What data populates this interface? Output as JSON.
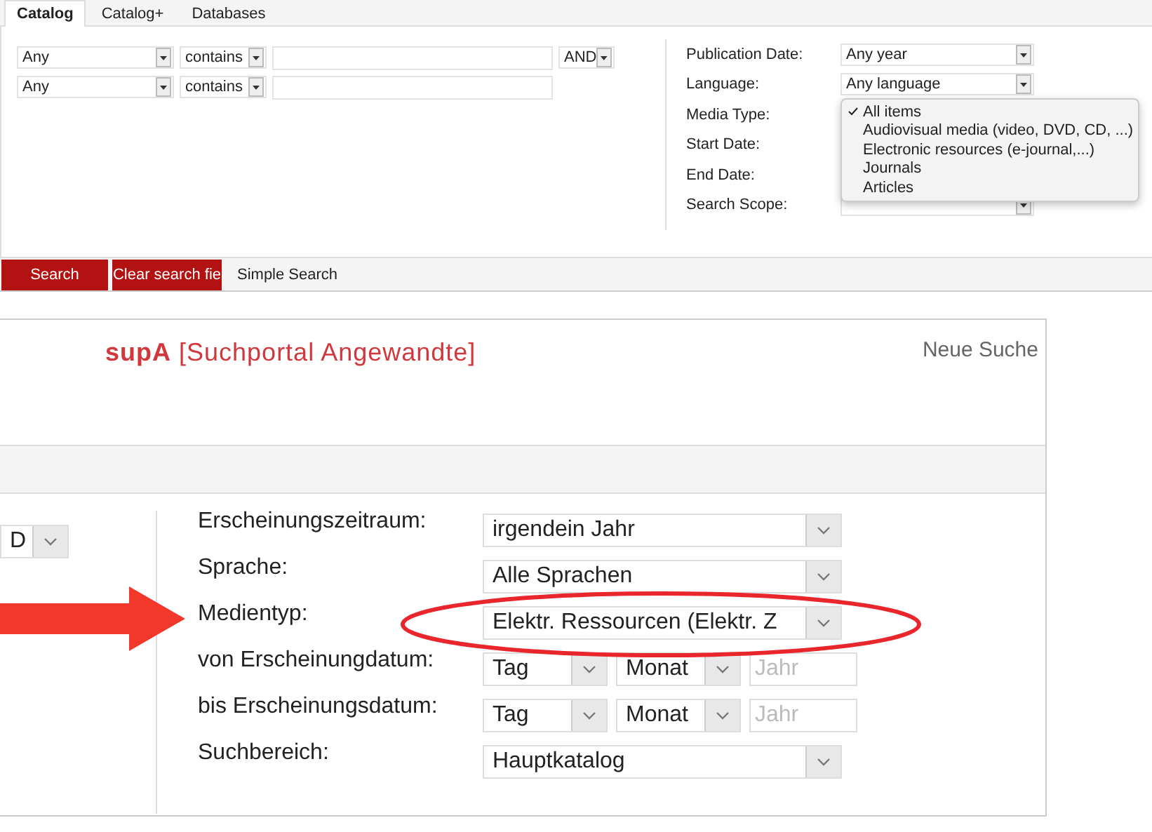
{
  "top_panel": {
    "tabs": [
      {
        "label": "Catalog",
        "selected": true
      },
      {
        "label": "Catalog+",
        "selected": false
      },
      {
        "label": "Databases",
        "selected": false
      }
    ],
    "query_rows": [
      {
        "field": "Any",
        "operator": "contains",
        "boolean": "AND"
      },
      {
        "field": "Any",
        "operator": "contains"
      }
    ],
    "filters": [
      {
        "kind": "select",
        "label": "Publication Date:",
        "value": "Any year"
      },
      {
        "kind": "select",
        "label": "Language:",
        "value": "Any language"
      },
      {
        "kind": "label_only",
        "label": "Media Type:"
      },
      {
        "kind": "label_only",
        "label": "Start Date:"
      },
      {
        "kind": "label_only",
        "label": "End Date:"
      },
      {
        "kind": "select",
        "label": "Search Scope:"
      }
    ],
    "media_type_menu": [
      {
        "label": "All items",
        "selected": true
      },
      {
        "label": "Audiovisual media (video, DVD, CD, ...)",
        "selected": false
      },
      {
        "label": "Electronic resources (e-journal,...)",
        "selected": false
      },
      {
        "label": "Journals",
        "selected": false
      },
      {
        "label": "Articles",
        "selected": false
      }
    ],
    "buttons": [
      "Search",
      "Clear search fie"
    ],
    "simple_search_link": "Simple Search"
  },
  "bottom_panel": {
    "logo": {
      "brand": "supA",
      "subtitle": "[Suchportal Angewandte]"
    },
    "new_search_link": "Neue Suche",
    "boolean_select_fragment": "D",
    "filters": [
      {
        "kind": "select",
        "label": "Erscheinungszeitraum:",
        "value": "irgendein Jahr"
      },
      {
        "kind": "select",
        "label": "Sprache:",
        "value": "Alle Sprachen"
      },
      {
        "kind": "select",
        "label": "Medientyp:",
        "value": "Elektr. Ressourcen (Elektr. Z"
      },
      {
        "kind": "date",
        "label": "von Erscheinungdatum:",
        "day": "Tag",
        "month": "Monat",
        "year_placeholder": "Jahr"
      },
      {
        "kind": "date",
        "label": "bis Erscheinungsdatum:",
        "day": "Tag",
        "month": "Monat",
        "year_placeholder": "Jahr"
      },
      {
        "kind": "select",
        "label": "Suchbereich:",
        "value": "Hauptkatalog"
      }
    ]
  }
}
